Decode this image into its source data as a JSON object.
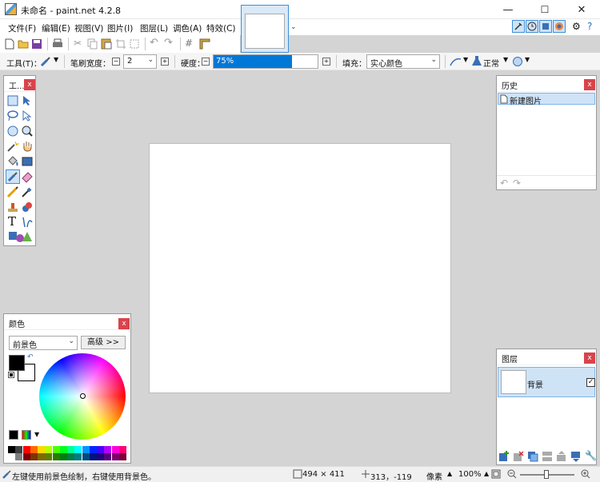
{
  "window": {
    "title": "未命名 - paint.net 4.2.8",
    "min": "—",
    "max": "☐",
    "close": "✕"
  },
  "menu": [
    "文件(F)",
    "编辑(E)",
    "视图(V)",
    "图片(I)",
    "图层(L)",
    "调色(A)",
    "特效(C)"
  ],
  "tool_options": {
    "tool_label": "工具(T)：",
    "brush_width_label": "笔刷宽度：",
    "brush_width_value": "2",
    "hardness_label": "硬度：",
    "hardness_value": "75%",
    "hardness_level": 0.75,
    "fill_label": "填充：",
    "fill_value": "实心颜色",
    "blend_value": "正常"
  },
  "tools_panel": {
    "title": "工...",
    "close": "x"
  },
  "history_panel": {
    "title": "历史",
    "close": "x",
    "items": [
      "新建图片"
    ]
  },
  "layers_panel": {
    "title": "图层",
    "close": "x",
    "layers": [
      {
        "name": "背景",
        "visible": true
      }
    ]
  },
  "colors_panel": {
    "title": "颜色",
    "close": "x",
    "select_value": "前景色",
    "advanced_button": "高级 >>"
  },
  "status": {
    "hint": "左键使用前景色绘制，右键使用背景色。",
    "image_size": "494 × 411",
    "cursor_pos": "313，-119",
    "units": "像素",
    "zoom": "100%"
  },
  "palette_row1": [
    "#000000",
    "#404040",
    "#ff0000",
    "#ff6a00",
    "#ffd800",
    "#b6ff00",
    "#4cff00",
    "#00ff21",
    "#00ff90",
    "#00ffff",
    "#0094ff",
    "#0026ff",
    "#4800ff",
    "#b200ff",
    "#ff00dc",
    "#ff006e"
  ],
  "palette_row2": [
    "#ffffff",
    "#808080",
    "#7f0000",
    "#7f3300",
    "#7f6a00",
    "#5b7f00",
    "#267f00",
    "#007f0e",
    "#007f46",
    "#007f7f",
    "#004a7f",
    "#00137f",
    "#21007f",
    "#57007f",
    "#7f006e",
    "#7f0037"
  ]
}
